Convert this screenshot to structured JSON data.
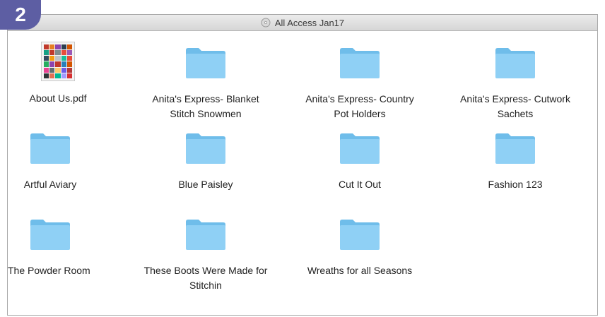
{
  "step": "2",
  "window": {
    "title": "All Access Jan17"
  },
  "files": [
    {
      "name": "About Us.pdf",
      "type": "pdf"
    },
    {
      "name": "Anita's Express- Blanket",
      "name2": "Stitch Snowmen",
      "type": "folder"
    },
    {
      "name": "Anita's Express- Country",
      "name2": "Pot Holders",
      "type": "folder"
    },
    {
      "name": "Anita's Express- Cutwork",
      "name2": "Sachets",
      "type": "folder"
    },
    {
      "name": "Artful Aviary",
      "type": "folder"
    },
    {
      "name": "Blue Paisley",
      "type": "folder"
    },
    {
      "name": "Cut It Out",
      "type": "folder"
    },
    {
      "name": "Fashion 123",
      "type": "folder"
    },
    {
      "name": "The Powder Room",
      "type": "folder"
    },
    {
      "name": "These Boots Were Made for",
      "name2": "Stitchin",
      "type": "folder"
    },
    {
      "name": "Wreaths for all Seasons",
      "type": "folder"
    }
  ],
  "colors": {
    "badge": "#5d5ea3",
    "folder": "#8fd0f5",
    "folder_tab": "#6fbdea"
  }
}
